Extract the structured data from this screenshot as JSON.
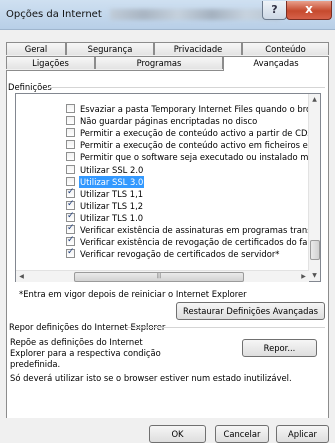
{
  "window": {
    "title": "Opções da Internet",
    "help_glyph": "?",
    "close_glyph": "x"
  },
  "tabs": {
    "row1": [
      "Geral",
      "Segurança",
      "Privacidade",
      "Conteúdo"
    ],
    "row2": [
      "Ligações",
      "Programas",
      "Avançadas"
    ],
    "active": "Avançadas"
  },
  "settings": {
    "group_label": "Definições",
    "items": [
      {
        "label": "Esvaziar a pasta Temporary Internet Files quando o brows",
        "checked": false,
        "selected": false
      },
      {
        "label": "Não guardar páginas encriptadas no disco",
        "checked": false,
        "selected": false
      },
      {
        "label": "Permitir a execução de conteúdo activo a partir de CDs em",
        "checked": false,
        "selected": false
      },
      {
        "label": "Permitir a execução de conteúdo activo em ficheiros em O",
        "checked": false,
        "selected": false
      },
      {
        "label": "Permitir que o software seja executado ou instalado mesm",
        "checked": false,
        "selected": false
      },
      {
        "label": "Utilizar SSL 2.0",
        "checked": false,
        "selected": false
      },
      {
        "label": "Utilizar SSL 3.0",
        "checked": false,
        "selected": true
      },
      {
        "label": "Utilizar TLS 1,1",
        "checked": true,
        "selected": false
      },
      {
        "label": "Utilizar TLS 1,2",
        "checked": true,
        "selected": false
      },
      {
        "label": "Utilizar TLS 1.0",
        "checked": true,
        "selected": false
      },
      {
        "label": "Verificar existência de assinaturas em programas transferi",
        "checked": true,
        "selected": false
      },
      {
        "label": "Verificar existência de revogação de certificados do fabric",
        "checked": true,
        "selected": false
      },
      {
        "label": "Verificar revogação de certificados de servidor*",
        "checked": true,
        "selected": false
      }
    ],
    "note": "*Entra em vigor depois de reiniciar o Internet Explorer",
    "restore_button": "Restaurar Definições Avançadas"
  },
  "reset": {
    "group_label": "Repor definições do Internet Explorer",
    "description": "Repõe as definições do Internet Explorer para a respectiva condição predefinida.",
    "button": "Repor...",
    "warning": "Só deverá utilizar isto se o browser estiver num estado inutilizável."
  },
  "footer": {
    "ok": "OK",
    "cancel": "Cancelar",
    "apply": "Aplicar"
  },
  "colors": {
    "selection": "#3399ff",
    "close_button": "#c64a2e",
    "titlebar": "#b8cfe7"
  }
}
